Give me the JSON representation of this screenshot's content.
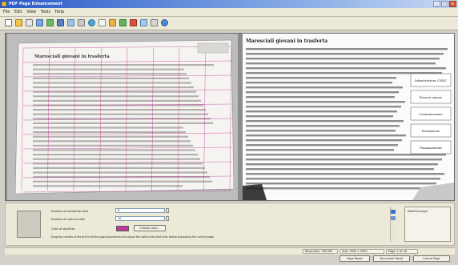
{
  "window": {
    "title": "PDF Page Enhancement"
  },
  "menu": [
    "File",
    "Edit",
    "View",
    "Tools",
    "Help"
  ],
  "toolbar_icons": [
    "new-icon",
    "open-icon",
    "zoom-icon",
    "crop-icon",
    "image-icon",
    "save-icon",
    "grid-icon",
    "print-icon",
    "refresh-icon",
    "page-icon",
    "color-icon",
    "check-icon",
    "flag-icon",
    "layout-icon",
    "rotate-icon",
    "help-icon"
  ],
  "document": {
    "heading": "Maresciali giovani in trasferta",
    "boxes": [
      "Infrastrutture CNDC",
      "Risorse umane",
      "Comunicazione",
      "Formazione",
      "Finanziamenti"
    ]
  },
  "bottom_panel": {
    "fields": [
      {
        "label": "Number of horizontal slots",
        "value": "8"
      },
      {
        "label": "Number of vertical slots",
        "value": "10"
      }
    ],
    "color_label": "Color of gridlines",
    "change_color_button": "Choose color...",
    "hint": "Drag the corners of the grid to fit the page boundaries and adjust the slots to the text lines before processing the current page",
    "side_panel_title": "Modified page"
  },
  "status": {
    "cells": [
      "Resolution: 300 DPI",
      "Size: 2552 x 3300",
      "Page: 1 of 16"
    ]
  },
  "actions": [
    "Page Reset",
    "Document Reset",
    "Cancel Page"
  ],
  "colors": {
    "grid": "#c2389a",
    "title_bar": "#2a5ac8"
  }
}
